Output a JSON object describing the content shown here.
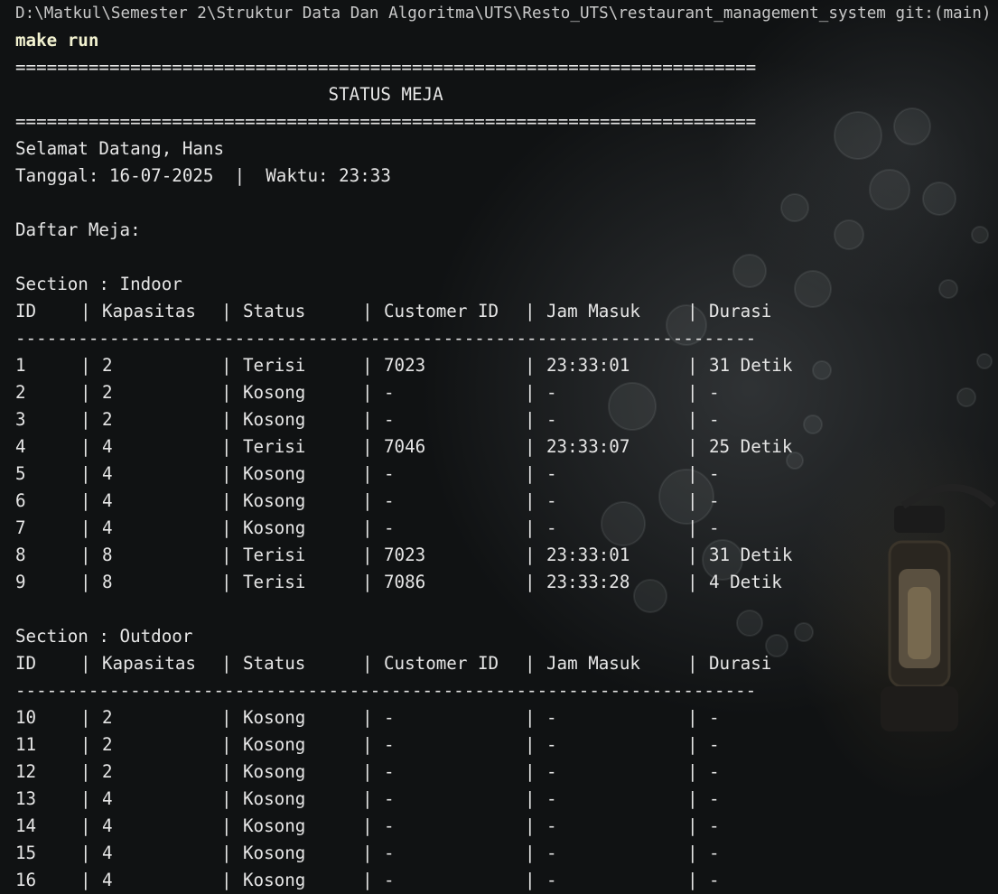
{
  "terminal": {
    "path_line": "D:\\Matkul\\Semester 2\\Struktur Data Dan Algoritma\\UTS\\Resto_UTS\\restaurant_management_system git:(main)",
    "command": "make run",
    "rule_double": "=======================================================================",
    "title": "                              STATUS MEJA",
    "welcome": "Selamat Datang, Hans",
    "date_time": "Tanggal: 16-07-2025  |  Waktu: 23:33",
    "list_heading": "Daftar Meja:",
    "rule_single": "-----------------------------------------------------------------------",
    "separator": "| "
  },
  "columns": [
    "ID",
    "Kapasitas",
    "Status",
    "Customer ID",
    "Jam Masuk",
    "Durasi"
  ],
  "sections": [
    {
      "title": "Section : Indoor",
      "rows": [
        [
          "1",
          "2",
          "Terisi",
          "7023",
          "23:33:01",
          "31 Detik"
        ],
        [
          "2",
          "2",
          "Kosong",
          "-",
          "-",
          "-"
        ],
        [
          "3",
          "2",
          "Kosong",
          "-",
          "-",
          "-"
        ],
        [
          "4",
          "4",
          "Terisi",
          "7046",
          "23:33:07",
          "25 Detik"
        ],
        [
          "5",
          "4",
          "Kosong",
          "-",
          "-",
          "-"
        ],
        [
          "6",
          "4",
          "Kosong",
          "-",
          "-",
          "-"
        ],
        [
          "7",
          "4",
          "Kosong",
          "-",
          "-",
          "-"
        ],
        [
          "8",
          "8",
          "Terisi",
          "7023",
          "23:33:01",
          "31 Detik"
        ],
        [
          "9",
          "8",
          "Terisi",
          "7086",
          "23:33:28",
          "4 Detik"
        ]
      ]
    },
    {
      "title": "Section : Outdoor",
      "rows": [
        [
          "10",
          "2",
          "Kosong",
          "-",
          "-",
          "-"
        ],
        [
          "11",
          "2",
          "Kosong",
          "-",
          "-",
          "-"
        ],
        [
          "12",
          "2",
          "Kosong",
          "-",
          "-",
          "-"
        ],
        [
          "13",
          "4",
          "Kosong",
          "-",
          "-",
          "-"
        ],
        [
          "14",
          "4",
          "Kosong",
          "-",
          "-",
          "-"
        ],
        [
          "15",
          "4",
          "Kosong",
          "-",
          "-",
          "-"
        ],
        [
          "16",
          "4",
          "Kosong",
          "-",
          "-",
          "-"
        ]
      ]
    }
  ],
  "colors": {
    "background": "#101213",
    "text": "#e6e6e6",
    "command": "#f2f2d0"
  }
}
